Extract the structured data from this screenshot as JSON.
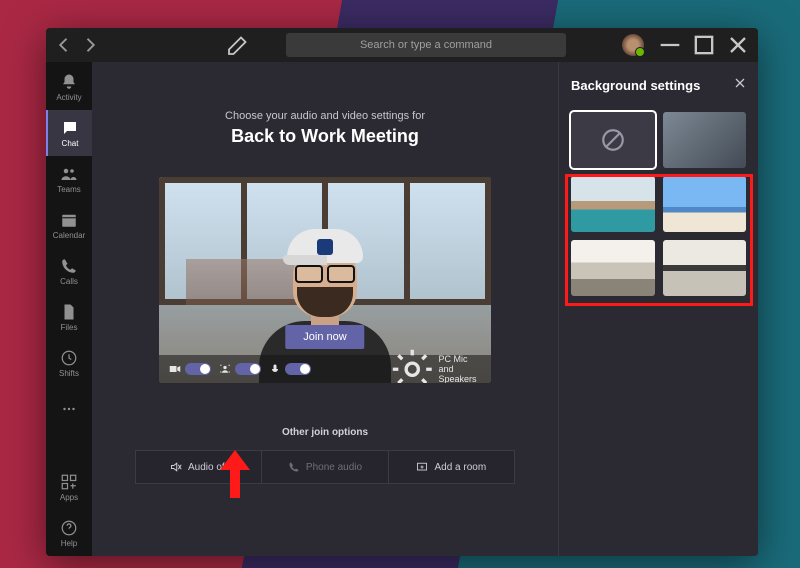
{
  "search": {
    "placeholder": "Search or type a command"
  },
  "rail": {
    "activity": "Activity",
    "chat": "Chat",
    "teams": "Teams",
    "calendar": "Calendar",
    "calls": "Calls",
    "files": "Files",
    "shifts": "Shifts",
    "apps": "Apps",
    "help": "Help"
  },
  "prejoin": {
    "subtitle": "Choose your audio and video settings for",
    "title": "Back to Work Meeting",
    "join": "Join now",
    "device": "PC Mic and Speakers",
    "otherOptions": "Other join options",
    "audioOff": "Audio off",
    "phoneAudio": "Phone audio",
    "addRoom": "Add a room"
  },
  "panel": {
    "title": "Background settings"
  }
}
